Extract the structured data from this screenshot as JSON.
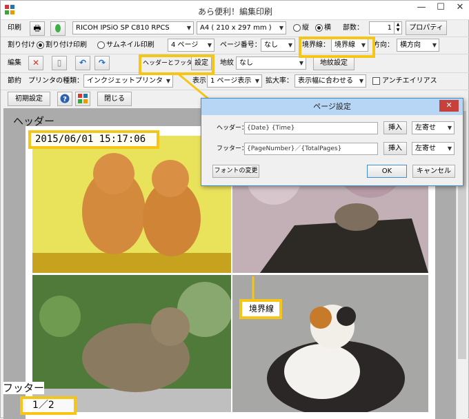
{
  "window": {
    "title": "あら便利！編集印刷",
    "minimize": "—",
    "maximize": "☐",
    "close": "✕"
  },
  "row1": {
    "print_label": "印刷",
    "printer": "RICOH IPSiO SP C810 RPCS",
    "paper": "A4 ( 210 x 297 mm )",
    "portrait_label": "縦",
    "landscape_label": "横",
    "copies_label": "部数：",
    "copies_value": "1",
    "properties_button": "プロパティ"
  },
  "row2": {
    "layout_label": "割り付け",
    "layout_print_label": "割り付け印刷",
    "thumbnail_print_label": "サムネイル印刷",
    "pages_value": "4 ページ",
    "page_number_label": "ページ番号：",
    "page_number_value": "なし",
    "border_label": "境界線：",
    "border_value": "境界線",
    "direction_label": "方向：",
    "direction_value": "横方向"
  },
  "row3": {
    "edit_label": "編集",
    "header_footer_label": "ヘッダーとフッター",
    "settings_button": "設定",
    "background_label": "地紋",
    "background_value": "なし",
    "background_button": "地紋設定"
  },
  "row4": {
    "save_label": "節約",
    "printer_type_label": "プリンタの種類：",
    "printer_type_value": "インクジェットプリンタ",
    "display_label": "表示",
    "display_value": "1 ページ表示",
    "zoom_label": "拡大率：",
    "zoom_value": "表示幅に合わせる",
    "antialias_label": "アンチエイリアス"
  },
  "row5": {
    "reset_button": "初期設定",
    "close_button": "閉じる"
  },
  "preview": {
    "header_annotation": "ヘッダー",
    "header_text": "2015/06/01 15:17:06",
    "footer_annotation": "フッター",
    "footer_text": "1／2",
    "border_annotation": "境界線"
  },
  "dialog": {
    "title": "ページ設定",
    "header_label": "ヘッダー：",
    "header_value": "{Date} {Time}",
    "footer_label": "フッター：",
    "footer_value": "{PageNumber}／{TotalPages}",
    "insert_button": "挿入",
    "align_value": "左寄せ",
    "font_button": "フォントの変更",
    "ok_button": "OK",
    "cancel_button": "キャンセル"
  },
  "colors": {
    "highlight": "#f5c518",
    "dialog_title_bg": "#b7d6f5",
    "close_red": "#c7413a"
  }
}
